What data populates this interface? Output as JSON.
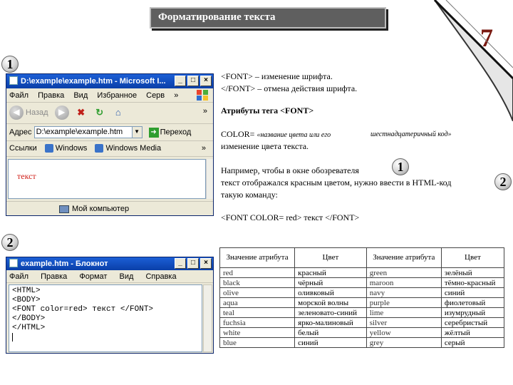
{
  "slide": {
    "title": "Форматирование текста",
    "page_number": "7"
  },
  "markers": {
    "one": "1",
    "two": "2"
  },
  "ie_window": {
    "title": "D:\\example\\example.htm - Microsoft I...",
    "menu": [
      "Файл",
      "Правка",
      "Вид",
      "Избранное",
      "Серв"
    ],
    "menu_more": "»",
    "toolbar": {
      "back": "Назад",
      "more": "»"
    },
    "address_label": "Адрес",
    "address_value": "D:\\example\\example.htm",
    "go_label": "Переход",
    "links_label": "Ссылки",
    "links": [
      "Windows",
      "Windows Media"
    ],
    "links_more": "»",
    "content_text": "текст",
    "status_text": "Мой компьютер"
  },
  "notepad": {
    "title": "example.htm - Блокнот",
    "menu": [
      "Файл",
      "Правка",
      "Формат",
      "Вид",
      "Справка"
    ],
    "lines": [
      "<HTML>",
      "<BODY>",
      "<FONT color=red> текст </FONT>",
      "</BODY>",
      "</HTML>"
    ]
  },
  "description": {
    "line1": "<FONT> – изменение шрифта.",
    "line2": "</FONT> – отмена действия шрифта.",
    "attrs_heading": "Атрибуты тега <FONT>",
    "color_attr": "COLOR=",
    "color_hint1": "«название цвета или его",
    "color_hint2": "шестнадцатеричный код»",
    "color_desc": "изменение цвета текста.",
    "example_line1": "Например, чтобы в окне обозревателя",
    "example_line2": "текст отображался красным цветом, нужно ввести в HTML-код",
    "example_line3": "такую команду:",
    "code": "<FONT COLOR= red>  текст </FONT>"
  },
  "color_table": {
    "headers": [
      "Значение атрибута",
      "Цвет",
      "Значение атрибута",
      "Цвет"
    ],
    "rows": [
      [
        "red",
        "красный",
        "green",
        "зелёный"
      ],
      [
        "black",
        "чёрный",
        "maroon",
        "тёмно-красный"
      ],
      [
        "olive",
        "оливковый",
        "navy",
        "синий"
      ],
      [
        "aqua",
        "морской волны",
        "purple",
        "фиолетовый"
      ],
      [
        "teal",
        "зеленовато-синий",
        "lime",
        "изумрудный"
      ],
      [
        "fuchsia",
        "ярко-малиновый",
        "silver",
        "серебристый"
      ],
      [
        "white",
        "белый",
        "yellow",
        "жёлтый"
      ],
      [
        "blue",
        "синий",
        "grey",
        "серый"
      ]
    ]
  },
  "colors": {
    "title_bg": "#5f5f5f",
    "page_number": "#7a1a12",
    "demo_text": "#d0201a"
  }
}
